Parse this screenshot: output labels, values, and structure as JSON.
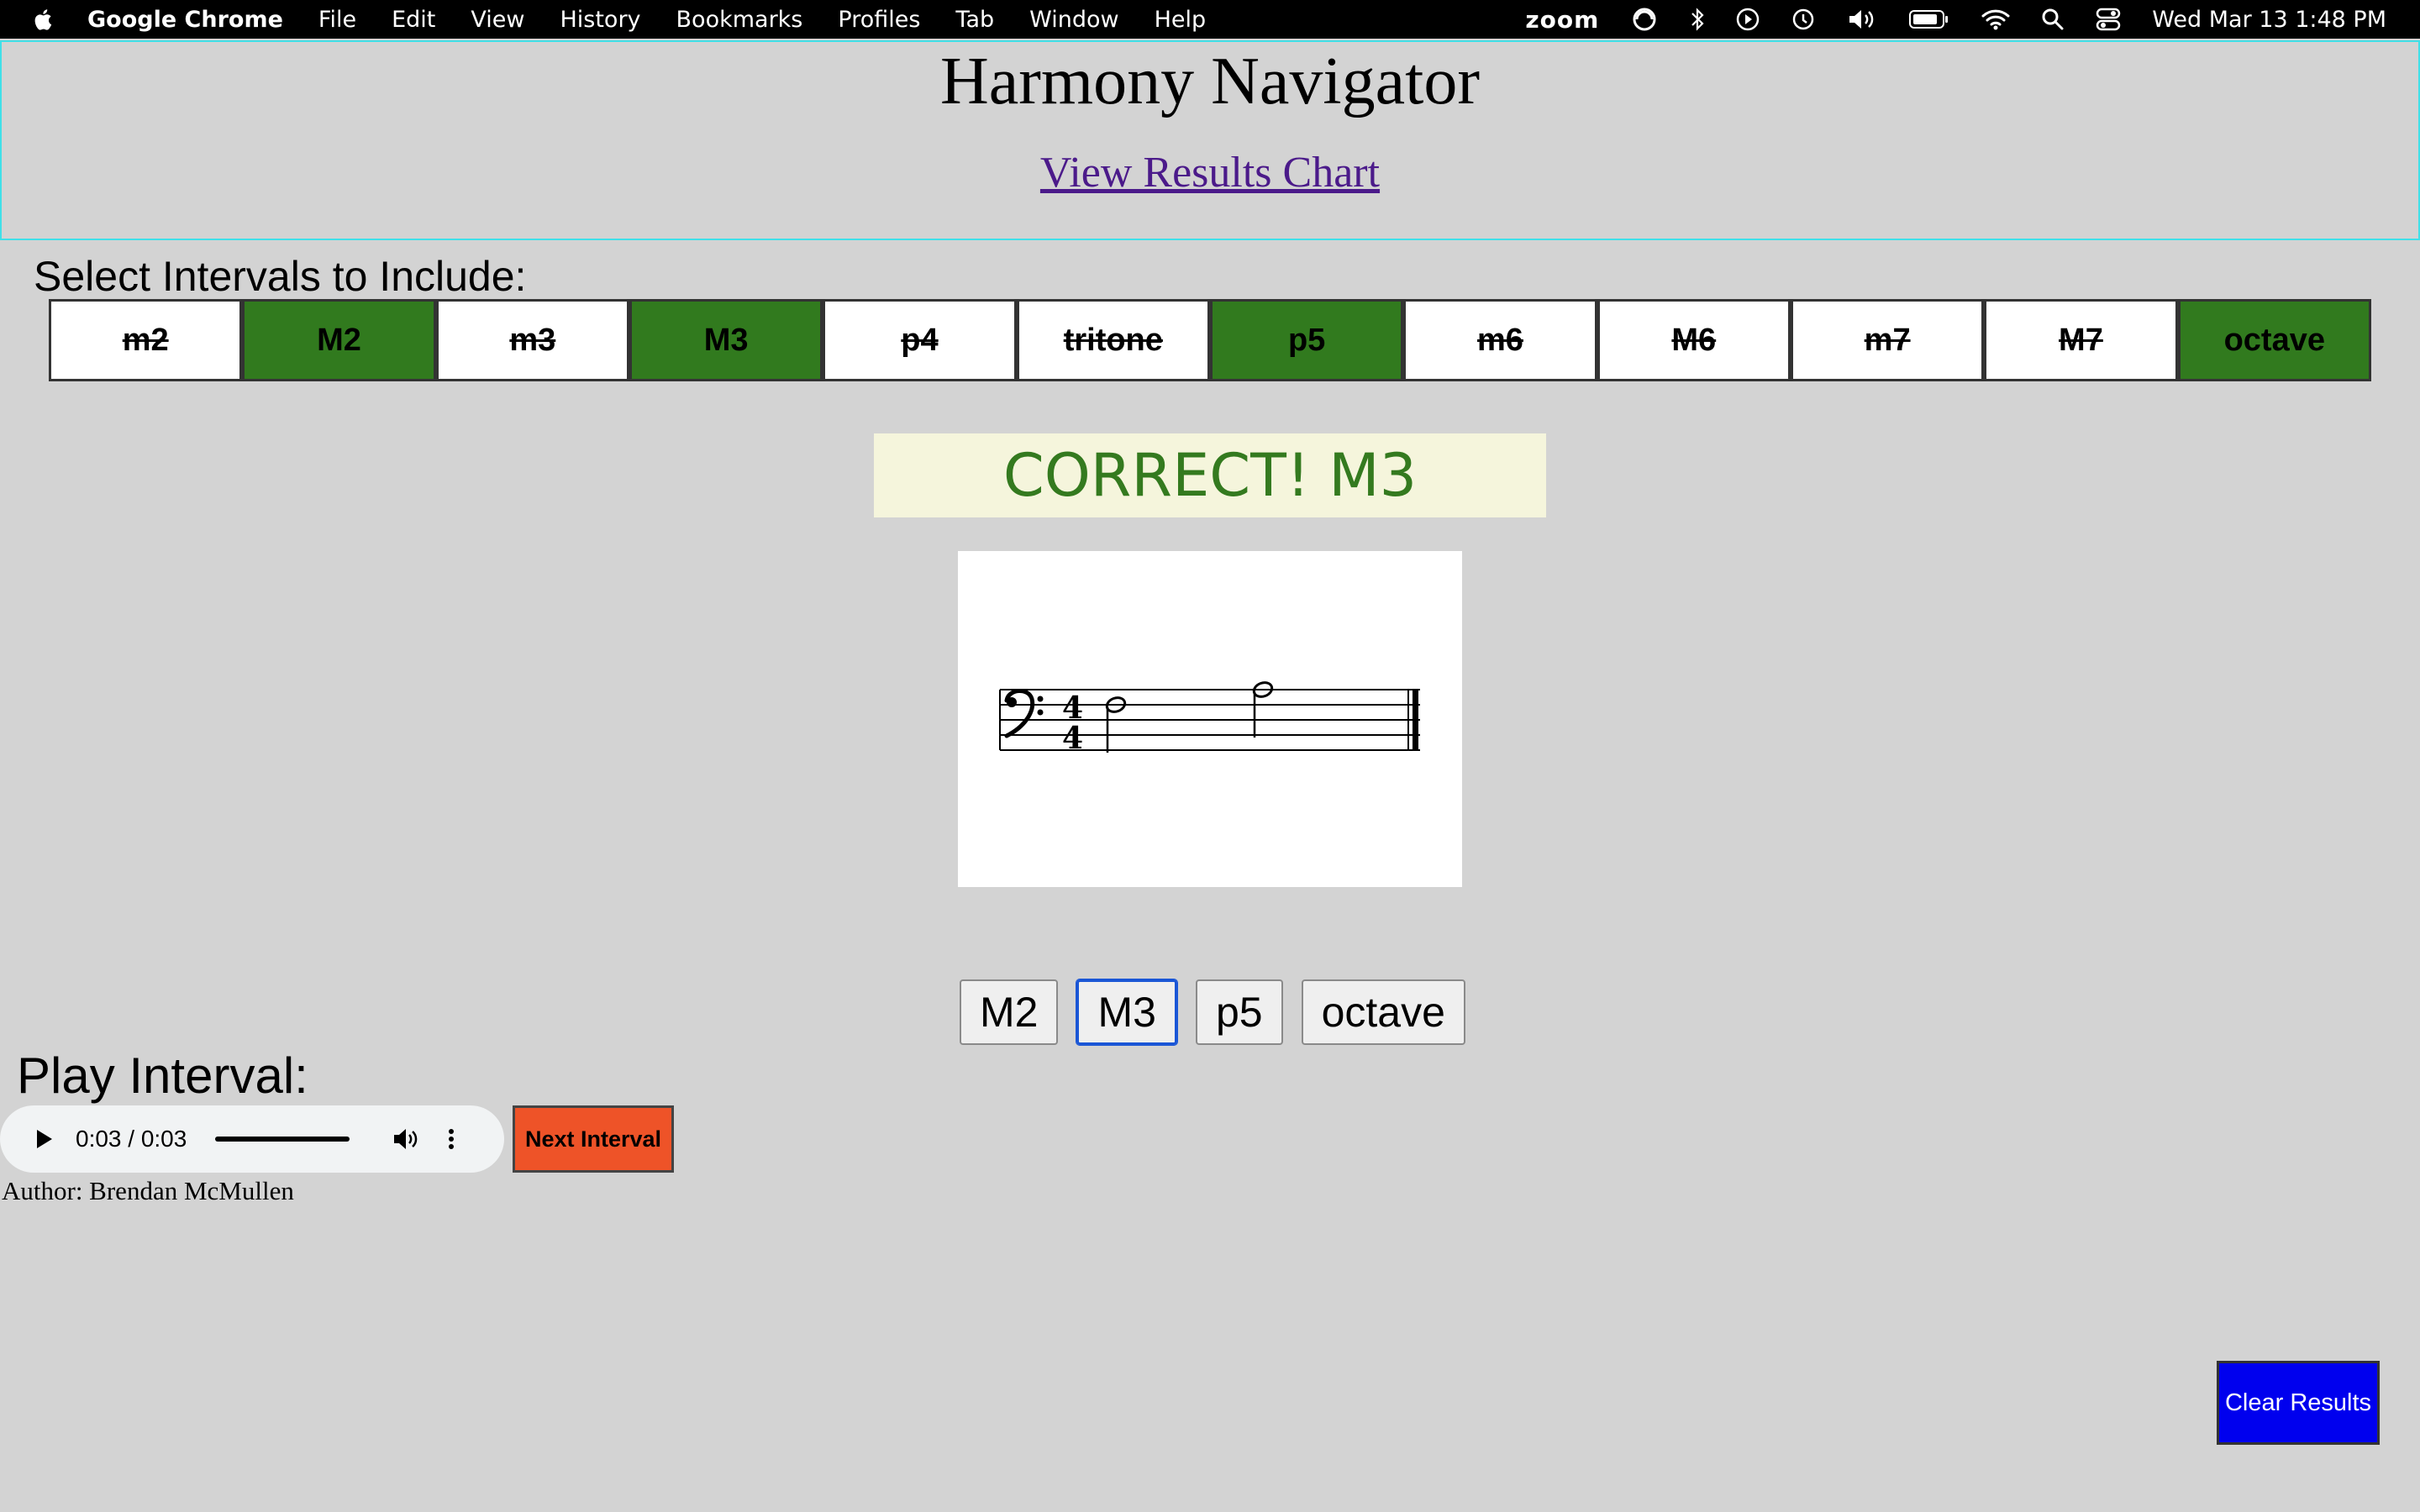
{
  "menubar": {
    "app_name": "Google Chrome",
    "items": [
      "File",
      "Edit",
      "View",
      "History",
      "Bookmarks",
      "Profiles",
      "Tab",
      "Window",
      "Help"
    ],
    "zoom_label": "zoom",
    "datetime": "Wed Mar 13  1:48 PM"
  },
  "header": {
    "title": "Harmony Navigator",
    "results_link": "View Results Chart"
  },
  "intervals": {
    "label": "Select Intervals to Include:",
    "items": [
      {
        "label": "m2",
        "selected": false
      },
      {
        "label": "M2",
        "selected": true
      },
      {
        "label": "m3",
        "selected": false
      },
      {
        "label": "M3",
        "selected": true
      },
      {
        "label": "p4",
        "selected": false
      },
      {
        "label": "tritone",
        "selected": false
      },
      {
        "label": "p5",
        "selected": true
      },
      {
        "label": "m6",
        "selected": false
      },
      {
        "label": "M6",
        "selected": false
      },
      {
        "label": "m7",
        "selected": false
      },
      {
        "label": "M7",
        "selected": false
      },
      {
        "label": "octave",
        "selected": true
      }
    ],
    "selected_color": "#317a1e"
  },
  "feedback": {
    "text": "CORRECT! M3",
    "color": "#347a1f"
  },
  "notation": {
    "clef": "bass",
    "time_signature": "4/4"
  },
  "answers": {
    "buttons": [
      "M2",
      "M3",
      "p5",
      "octave"
    ],
    "focused": "M3"
  },
  "player": {
    "label": "Play Interval:",
    "time": "0:03 / 0:03",
    "progress": 1.0,
    "next_label": "Next Interval",
    "next_color": "#ee5328"
  },
  "author": "Author: Brendan McMullen",
  "clear_button": {
    "label": "Clear Results",
    "color": "#0000ee"
  }
}
